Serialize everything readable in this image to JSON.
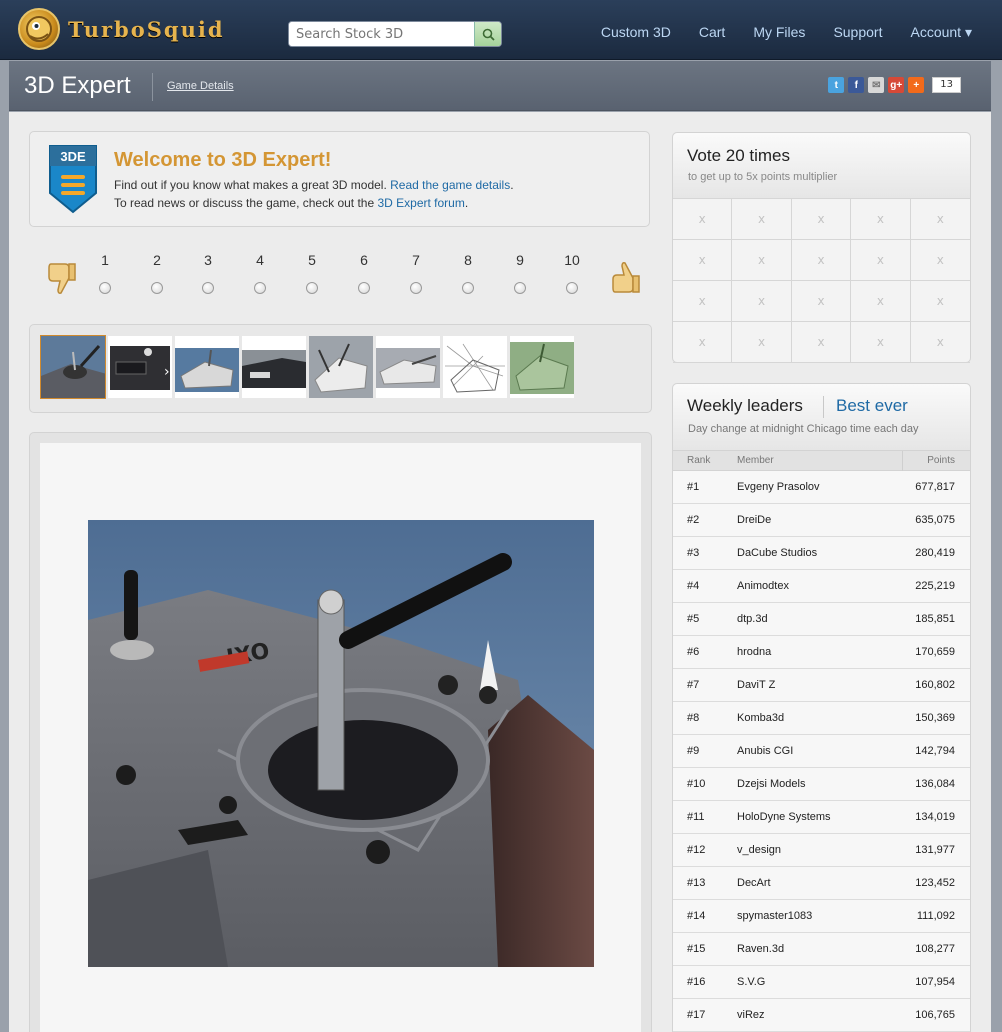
{
  "brand": {
    "name": "TurboSquid"
  },
  "search": {
    "placeholder": "Search Stock 3D"
  },
  "nav": [
    "Custom 3D",
    "Cart",
    "My Files",
    "Support",
    "Account ▾"
  ],
  "subheader": {
    "title": "3D Expert",
    "details_link": "Game Details",
    "share_count": "13"
  },
  "share_icons": [
    "twitter-icon",
    "facebook-icon",
    "email-icon",
    "google-plus-icon",
    "addthis-icon"
  ],
  "welcome": {
    "badge": "3DE",
    "title": "Welcome to 3D Expert!",
    "line1_pre": "Find out if you know what makes a great 3D model. ",
    "line1_link": "Read the game details",
    "line1_post": ".",
    "line2_pre": "To read news or discuss the game, check out the ",
    "line2_link": "3D Expert forum",
    "line2_post": "."
  },
  "rating": {
    "options": [
      "1",
      "2",
      "3",
      "4",
      "5",
      "6",
      "7",
      "8",
      "9",
      "10"
    ],
    "selected": null
  },
  "vote": {
    "title": "Vote 20 times",
    "subtitle": "to get up to 5x points multiplier",
    "cells": [
      "x",
      "x",
      "x",
      "x",
      "x",
      "x",
      "x",
      "x",
      "x",
      "x",
      "x",
      "x",
      "x",
      "x",
      "x",
      "x",
      "x",
      "x",
      "x",
      "x"
    ]
  },
  "leaders": {
    "title": "Weekly leaders",
    "alt_tab": "Best ever",
    "subtitle": "Day change at midnight Chicago time each day",
    "columns": {
      "rank": "Rank",
      "member": "Member",
      "points": "Points"
    },
    "rows": [
      {
        "rank": "#1",
        "member": "Evgeny Prasolov",
        "points": "677,817"
      },
      {
        "rank": "#2",
        "member": "DreiDe",
        "points": "635,075"
      },
      {
        "rank": "#3",
        "member": "DaCube Studios",
        "points": "280,419"
      },
      {
        "rank": "#4",
        "member": "Animodtex",
        "points": "225,219"
      },
      {
        "rank": "#5",
        "member": "dtp.3d",
        "points": "185,851"
      },
      {
        "rank": "#6",
        "member": "hrodna",
        "points": "170,659"
      },
      {
        "rank": "#7",
        "member": "DaviT Z",
        "points": "160,802"
      },
      {
        "rank": "#8",
        "member": "Komba3d",
        "points": "150,369"
      },
      {
        "rank": "#9",
        "member": "Anubis CGI",
        "points": "142,794"
      },
      {
        "rank": "#10",
        "member": "Dzejsi Models",
        "points": "136,084"
      },
      {
        "rank": "#11",
        "member": "HoloDyne Systems",
        "points": "134,019"
      },
      {
        "rank": "#12",
        "member": "v_design",
        "points": "131,977"
      },
      {
        "rank": "#13",
        "member": "DecArt",
        "points": "123,452"
      },
      {
        "rank": "#14",
        "member": "spymaster1083",
        "points": "111,092"
      },
      {
        "rank": "#15",
        "member": "Raven.3d",
        "points": "108,277"
      },
      {
        "rank": "#16",
        "member": "S.V.G",
        "points": "107,954"
      },
      {
        "rank": "#17",
        "member": "viRez",
        "points": "106,765"
      }
    ]
  },
  "colors": {
    "accent": "#d49634",
    "link": "#1f6aa5",
    "nav_bg": "#22344d",
    "thumb_selected": "#d08a2e"
  }
}
